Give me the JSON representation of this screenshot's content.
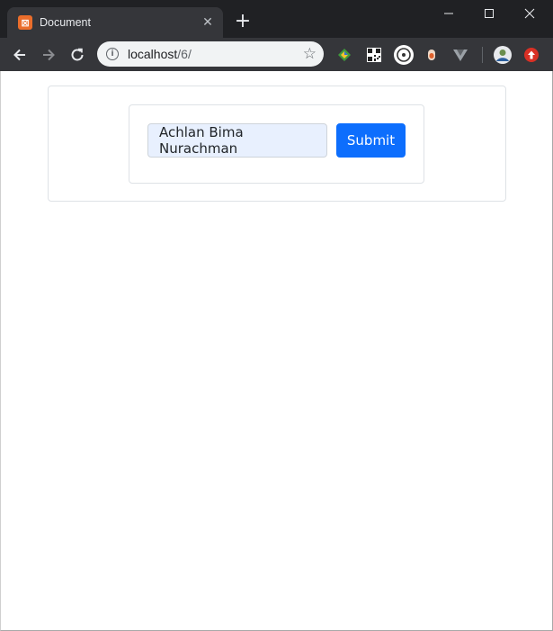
{
  "browser": {
    "tab": {
      "title": "Document",
      "favicon_letter": "⊠",
      "close_glyph": "✕"
    },
    "new_tab_glyph": "+",
    "window_controls": [
      "minimize",
      "maximize",
      "close"
    ],
    "address_bar": {
      "host": "localhost",
      "path": "/6/"
    },
    "colors": {
      "frame": "#202124",
      "toolbar": "#35363a",
      "omnibox": "#f1f3f4",
      "favicon": "#ea6d2b"
    }
  },
  "page": {
    "form": {
      "name_value": "Achlan Bima Nurachman",
      "submit_label": "Submit"
    },
    "colors": {
      "input_bg": "#e8f0fe",
      "button": "#0d6efd",
      "border": "#dee2e6"
    }
  }
}
